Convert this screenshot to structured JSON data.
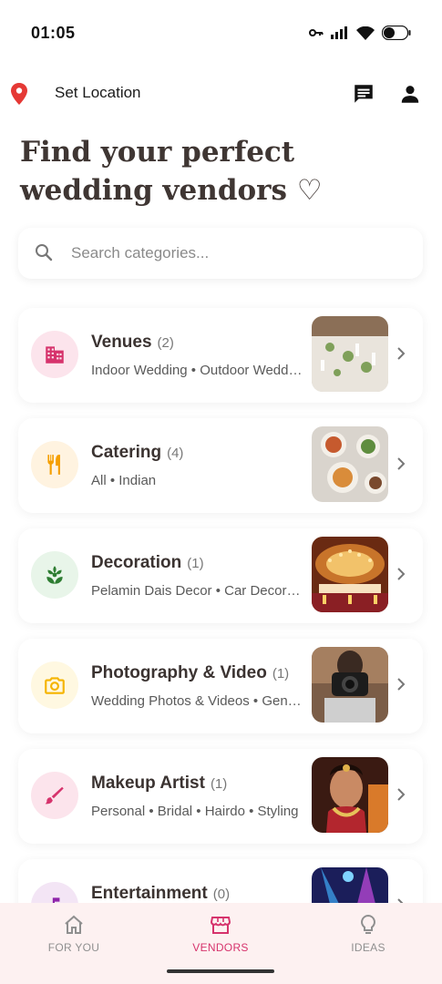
{
  "status_bar": {
    "time": "01:05"
  },
  "top_bar": {
    "location_label": "Set Location"
  },
  "headline": "Find your perfect wedding vendors ♡",
  "search": {
    "placeholder": "Search categories...",
    "value": ""
  },
  "categories": [
    {
      "title": "Venues",
      "count": "(2)",
      "subtitle": "Indoor Wedding • Outdoor Wedding",
      "icon": "building-icon",
      "accent": "#d6336c",
      "bg": "#fce4ec"
    },
    {
      "title": "Catering",
      "count": "(4)",
      "subtitle": "All • Indian",
      "icon": "fork-knife-icon",
      "accent": "#f59f00",
      "bg": "#fff3e0"
    },
    {
      "title": "Decoration",
      "count": "(1)",
      "subtitle": "Pelamin Dais Decor • Car Decor • Hall Decor",
      "icon": "flower-icon",
      "accent": "#2e7d32",
      "bg": "#e8f5e9"
    },
    {
      "title": "Photography & Video",
      "count": "(1)",
      "subtitle": "Wedding Photos & Videos • General",
      "icon": "camera-icon",
      "accent": "#f5b400",
      "bg": "#fff8e1"
    },
    {
      "title": "Makeup Artist",
      "count": "(1)",
      "subtitle": "Personal • Bridal • Hairdo • Styling",
      "icon": "brush-icon",
      "accent": "#d6336c",
      "bg": "#fce4ec"
    },
    {
      "title": "Entertainment",
      "count": "(0)",
      "subtitle": "",
      "icon": "music-icon",
      "accent": "#8e24aa",
      "bg": "#f3e5f5"
    }
  ],
  "bottom_nav": {
    "items": [
      {
        "label": "FOR YOU",
        "icon": "home-icon"
      },
      {
        "label": "VENDORS",
        "icon": "store-icon",
        "active": true
      },
      {
        "label": "IDEAS",
        "icon": "lightbulb-icon"
      }
    ]
  },
  "colors": {
    "accent": "#d6336c",
    "nav_bg": "#fdf1f1",
    "location_pin": "#e53935"
  }
}
